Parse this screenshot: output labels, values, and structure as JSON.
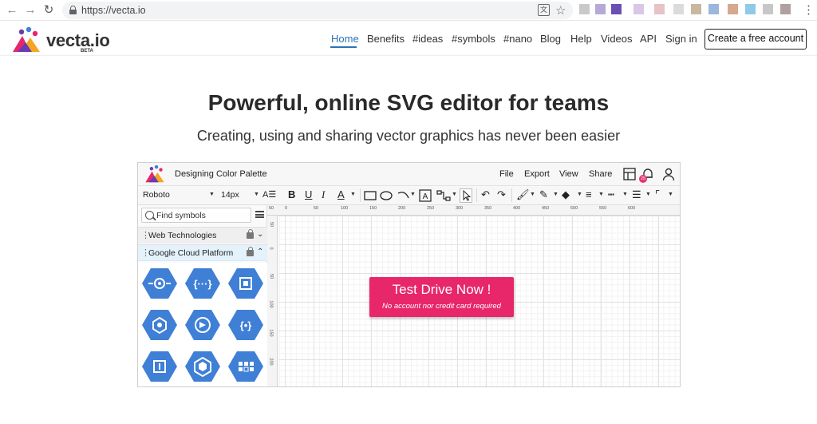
{
  "browser": {
    "url": "https://vecta.io",
    "back_icon": "arrow-left-icon",
    "forward_icon": "arrow-right-icon",
    "reload_icon": "reload-icon",
    "translate_label": "文"
  },
  "header": {
    "logo_text": "vecta.io",
    "logo_beta": "BETA",
    "nav": [
      "Home",
      "Benefits",
      "#ideas",
      "#symbols",
      "#nano",
      "Blog",
      "Help",
      "Videos",
      "API",
      "Sign in"
    ],
    "cta_label": "Create a free account"
  },
  "hero": {
    "title": "Powerful, online SVG editor for teams",
    "subtitle": "Creating, using and sharing vector graphics has never been easier"
  },
  "editor": {
    "doc_title": "Designing Color Palette",
    "menus": [
      "File",
      "Export",
      "View",
      "Share"
    ],
    "notification_count": "25",
    "toolbar": {
      "font": "Roboto",
      "font_size": "14px"
    },
    "sidebar": {
      "search_placeholder": "Find symbols",
      "groups": [
        {
          "label": "Web Technologies"
        },
        {
          "label": "Google Cloud Platform"
        }
      ]
    },
    "ruler_top": [
      "50",
      "0",
      "50",
      "100",
      "150",
      "200",
      "250",
      "300",
      "350",
      "400",
      "450",
      "500",
      "550",
      "600"
    ],
    "ruler_left": [
      "50",
      "0",
      "50",
      "100",
      "150",
      "200"
    ],
    "promo": {
      "title": "Test Drive Now !",
      "subtitle": "No account nor credit card required"
    }
  },
  "colors": {
    "accent": "#2b73b8",
    "promo": "#e8266a",
    "hex_icon": "#3f7fd6"
  }
}
